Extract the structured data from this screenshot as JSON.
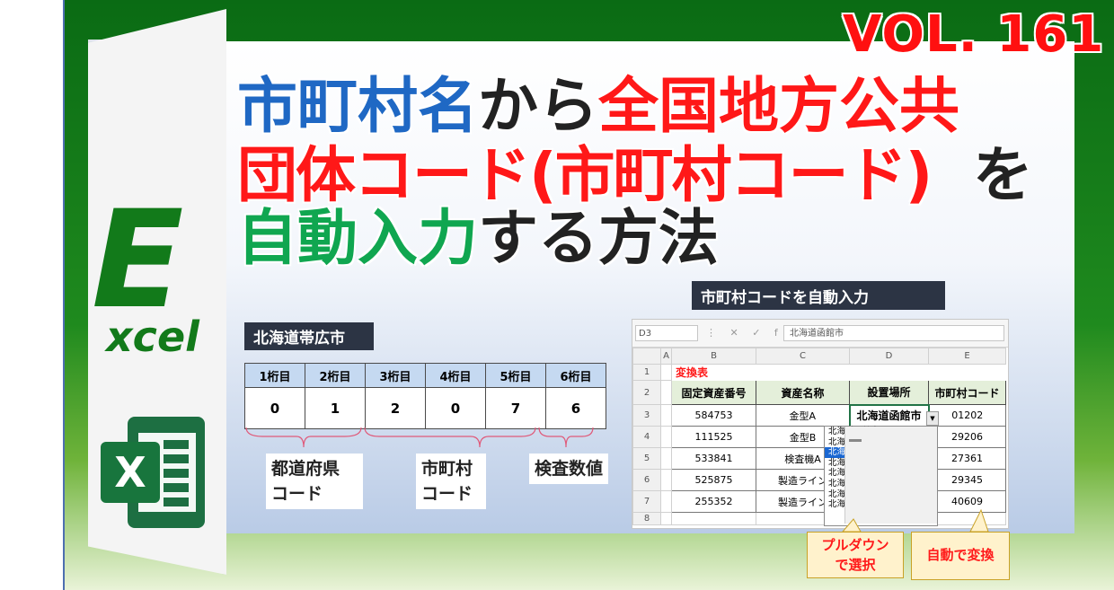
{
  "badge": {
    "vol": "VOL. 161"
  },
  "logo": {
    "letter_e": "E",
    "word_xcel": "xcel",
    "icon_letter": "X"
  },
  "title": {
    "line1": [
      {
        "text": "市町村名",
        "color": "blue"
      },
      {
        "text": "から",
        "color": "black"
      },
      {
        "text": "全国地方公共",
        "color": "red"
      }
    ],
    "line2": [
      {
        "text": "団体コード(市町村コード)",
        "color": "red"
      },
      {
        "text": "  を",
        "color": "black"
      }
    ],
    "line3": [
      {
        "text": "自動入力",
        "color": "green"
      },
      {
        "text": "する方法",
        "color": "black"
      }
    ]
  },
  "example": {
    "city_label": "北海道帯広市",
    "digit_headers": [
      "1桁目",
      "2桁目",
      "3桁目",
      "4桁目",
      "5桁目",
      "6桁目"
    ],
    "digit_values": [
      "0",
      "1",
      "2",
      "0",
      "7",
      "6"
    ],
    "caption_pref": [
      "都道府県",
      "コード"
    ],
    "caption_city": [
      "市町村",
      "コード"
    ],
    "caption_check": "検査数値"
  },
  "excel": {
    "section_label": "市町村コードを自動入力",
    "name_box": "D3",
    "fx_icons": "⋮ ✕ ✓ fx",
    "formula_value": "北海道函館市",
    "col_headers": [
      "A",
      "B",
      "C",
      "D",
      "E"
    ],
    "row_numbers": [
      "1",
      "2",
      "3",
      "4",
      "5",
      "6",
      "7",
      "8"
    ],
    "table_title": "変換表",
    "headers": [
      "固定資産番号",
      "資産名称",
      "設置場所",
      "市町村コード"
    ],
    "rows": [
      {
        "id": "584753",
        "name": "金型A",
        "place": "北海道函館市",
        "code": "01202"
      },
      {
        "id": "111525",
        "name": "金型B",
        "place": "",
        "code": "29206"
      },
      {
        "id": "533841",
        "name": "検査機A",
        "place": "",
        "code": "27361"
      },
      {
        "id": "525875",
        "name": "製造ライン",
        "place": "",
        "code": "29345"
      },
      {
        "id": "255352",
        "name": "製造ライン",
        "place": "",
        "code": "40609"
      }
    ],
    "dropdown_items": [
      "北海道函館市",
      "北海道小樽市",
      "北海道旭川市",
      "北海道室蘭市",
      "北海道釧路市",
      "北海道帯広市",
      "北海道北見市",
      "北海道夕張市"
    ],
    "dropdown_highlight": 2,
    "callout_dropdown": [
      "プルダウン",
      "で選択"
    ],
    "callout_auto": "自動で変換"
  },
  "colors": {
    "excel_green": "#127a1a",
    "title_blue": "#1f68c4",
    "title_red": "#ff1818",
    "title_green": "#10a650",
    "vol_red": "#ff1010"
  }
}
